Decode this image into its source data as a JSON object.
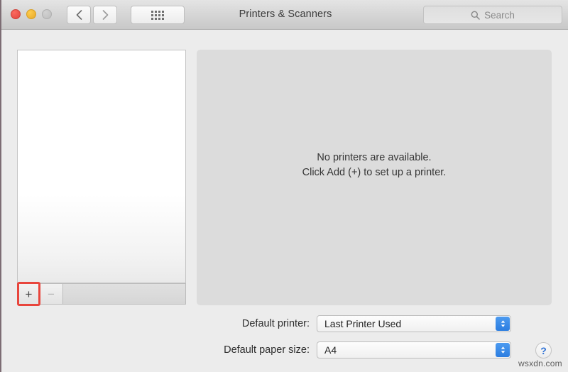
{
  "window": {
    "title": "Printers & Scanners"
  },
  "titlebar": {
    "close_label": "",
    "minimize_label": "",
    "zoom_label": "",
    "back_icon": "chevron-left-icon",
    "forward_icon": "chevron-right-icon",
    "grid_icon": "grid-dots-icon"
  },
  "search": {
    "placeholder": "Search",
    "icon": "search-icon"
  },
  "printer_list": {
    "items": [],
    "add_label": "+",
    "remove_label": "−"
  },
  "content": {
    "line1": "No printers are available.",
    "line2": "Click Add (+) to set up a printer."
  },
  "settings": {
    "default_printer": {
      "label": "Default printer:",
      "value": "Last Printer Used"
    },
    "default_paper_size": {
      "label": "Default paper size:",
      "value": "A4"
    }
  },
  "help": {
    "label": "?"
  },
  "watermark": {
    "text": "wsxdn.com"
  },
  "colors": {
    "accent_blue": "#2b7de0",
    "highlight_red": "#e8453c",
    "close_red": "#e0443e",
    "minimize_yellow": "#e5a82a"
  }
}
